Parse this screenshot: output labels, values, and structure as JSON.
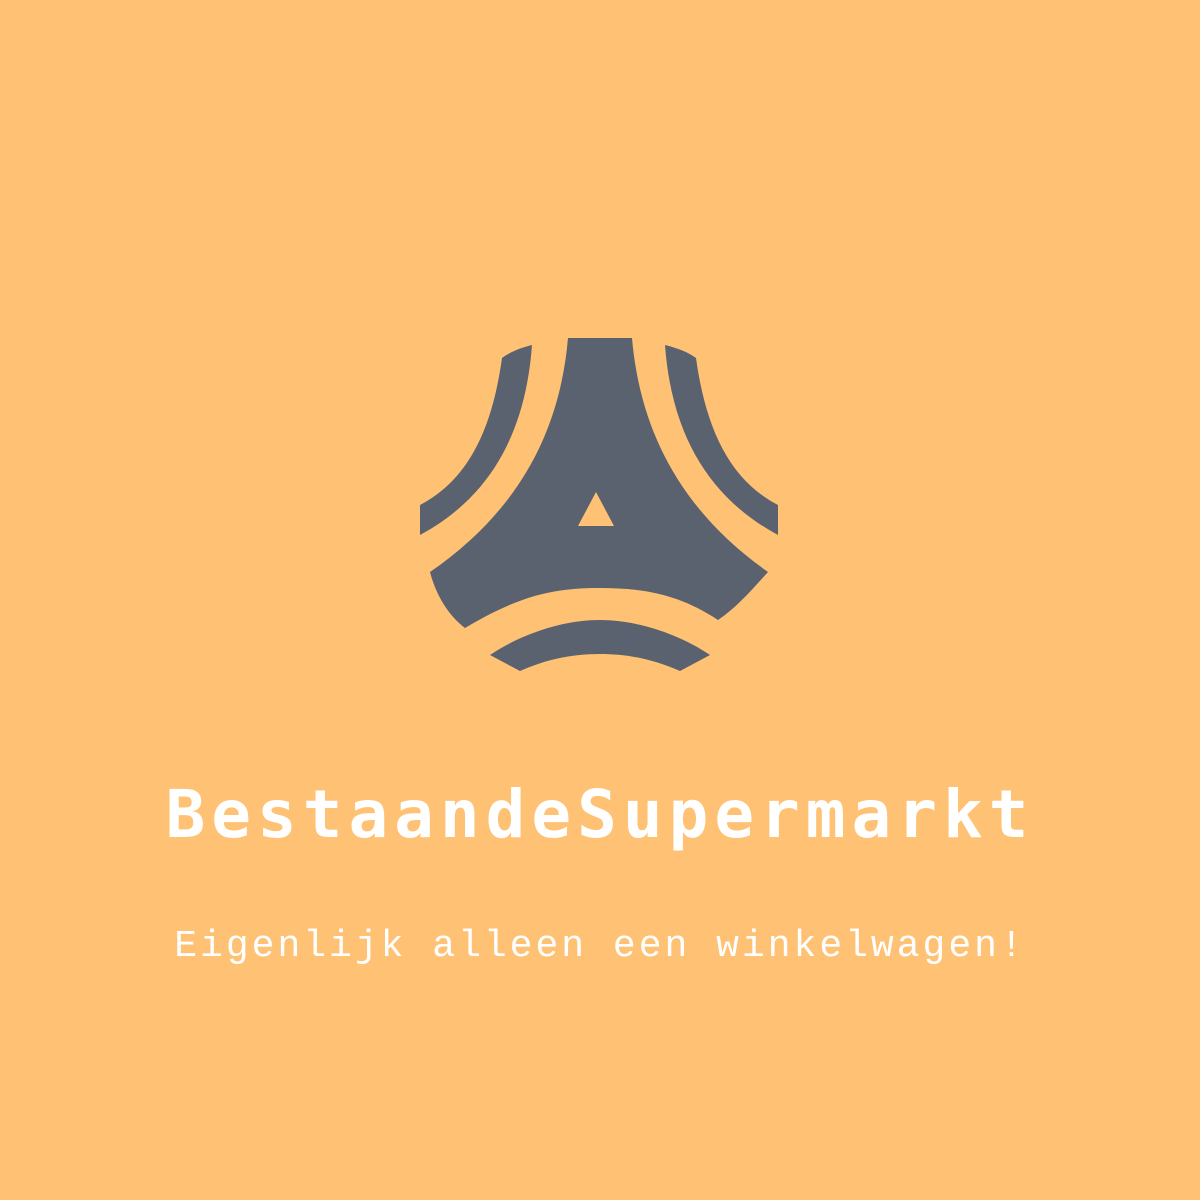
{
  "colors": {
    "background": "#FFC174",
    "logo": "#5A626F",
    "text": "#FFFFFF"
  },
  "logo": {
    "icon": "triangular-arc-emblem-icon"
  },
  "brand": {
    "name": "BestaandeSupermarkt"
  },
  "tagline": {
    "text": "Eigenlijk alleen een winkelwagen!"
  }
}
